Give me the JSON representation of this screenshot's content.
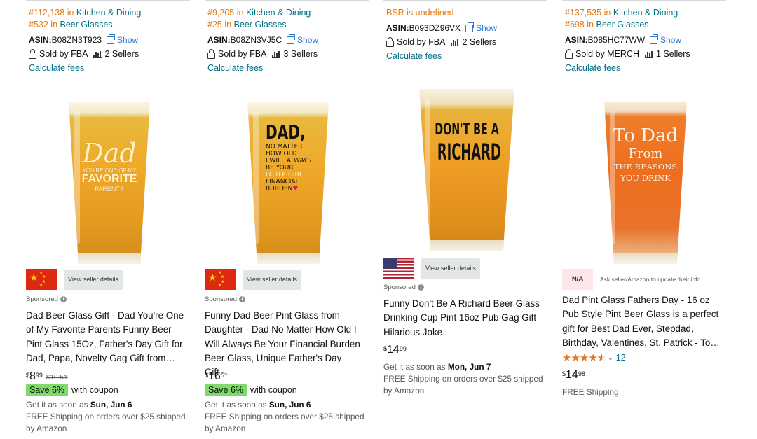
{
  "products": [
    {
      "rank1": "#112,138",
      "rank1_in": "in",
      "rank1_cat": "Kitchen & Dining",
      "rank2": "#532",
      "rank2_in": "in",
      "rank2_cat": "Beer Glasses",
      "asin_label": "ASIN:",
      "asin": "B08ZN3T923",
      "show": "Show",
      "sold_by": "Sold by FBA",
      "sellers": "2 Sellers",
      "calc": "Calculate fees",
      "glass_text_1": "Dad",
      "glass_text_2": "YOU'RE ONE OF MY",
      "glass_text_3": "FAVORITE",
      "glass_text_4": "PARENTS",
      "flag": "china-flag",
      "view_seller": "View seller details",
      "sponsored": "Sponsored",
      "title": "Dad Beer Glass Gift - Dad You're One of My Favorite Parents Funny Beer Pint Glass 15Oz, Father's Day Gift for Dad, Papa, Novelty Gag Gift from…",
      "price_currency": "$",
      "price_whole": "8",
      "price_frac": "99",
      "list_price": "$10.51",
      "coupon_badge": "Save 6%",
      "coupon_text": "with coupon",
      "delivery_prefix": "Get it as soon as",
      "delivery_date": "Sun, Jun 6",
      "shipping": "FREE Shipping on orders over $25 shipped by Amazon"
    },
    {
      "rank1": "#9,205",
      "rank1_in": "in",
      "rank1_cat": "Kitchen & Dining",
      "rank2": "#25",
      "rank2_in": "in",
      "rank2_cat": "Beer Glasses",
      "asin_label": "ASIN:",
      "asin": "B08ZN3VJ5C",
      "show": "Show",
      "sold_by": "Sold by FBA",
      "sellers": "3 Sellers",
      "calc": "Calculate fees",
      "glass_text_1": "DAD,",
      "glass_text_2": "NO MATTER",
      "glass_text_3": "HOW OLD",
      "glass_text_4": "I WILL ALWAYS",
      "glass_text_5": "BE YOUR",
      "glass_text_6": "LITTLE GIRL",
      "glass_text_7": "FINANCIAL",
      "glass_text_8": "BURDEN",
      "flag": "china-flag",
      "view_seller": "View seller details",
      "sponsored": "Sponsored",
      "title": "Funny Dad Beer Pint Glass from Daughter - Dad No Matter How Old I Will Always Be Your Financial Burden Beer Glass, Unique Father's Day Gift…",
      "price_currency": "$",
      "price_whole": "16",
      "price_frac": "51",
      "coupon_badge": "Save 6%",
      "coupon_text": "with coupon",
      "delivery_prefix": "Get it as soon as",
      "delivery_date": "Sun, Jun 6",
      "shipping": "FREE Shipping on orders over $25 shipped by Amazon"
    },
    {
      "bsr_undefined": "BSR is undefined",
      "asin_label": "ASIN:",
      "asin": "B093DZ96VX",
      "show": "Show",
      "sold_by": "Sold by FBA",
      "sellers": "2 Sellers",
      "calc": "Calculate fees",
      "glass_text_1": "DON'T BE A",
      "glass_text_2": "RICHARD",
      "flag": "usa-flag",
      "view_seller": "View seller details",
      "sponsored": "Sponsored",
      "title": "Funny Don't Be A Richard Beer Glass Drinking Cup Pint 16oz Pub Gag Gift Hilarious Joke",
      "price_currency": "$",
      "price_whole": "14",
      "price_frac": "99",
      "delivery_prefix": "Get it as soon as",
      "delivery_date": "Mon, Jun 7",
      "shipping": "FREE Shipping on orders over $25 shipped by Amazon"
    },
    {
      "rank1": "#137,535",
      "rank1_in": "in",
      "rank1_cat": "Kitchen & Dining",
      "rank2": "#698",
      "rank2_in": "in",
      "rank2_cat": "Beer Glasses",
      "asin_label": "ASIN:",
      "asin": "B085HC77WW",
      "show": "Show",
      "sold_by": "Sold by MERCH",
      "sellers": "1 Sellers",
      "calc": "Calculate fees",
      "glass_text_1": "To Dad",
      "glass_text_2": "From",
      "glass_text_3": "THE REASONS",
      "glass_text_4": "YOU DRINK",
      "na": "N/A",
      "ask_seller": "Ask seller/Amazon to update their info.",
      "title": "Dad Pint Glass Fathers Day - 16 oz Pub Style Pint Beer Glass is a perfect gift for Best Dad Ever, Stepdad, Birthday, Valentines, St. Patrick - To…",
      "rating": 4.5,
      "rating_count": "12",
      "price_currency": "$",
      "price_whole": "14",
      "price_frac": "98",
      "shipping": "FREE Shipping"
    }
  ],
  "colors": {
    "link": "#007185",
    "rank": "#e47911",
    "show": "#2d7bd6",
    "coupon_badge": "#7fda69",
    "star": "#de7921"
  }
}
